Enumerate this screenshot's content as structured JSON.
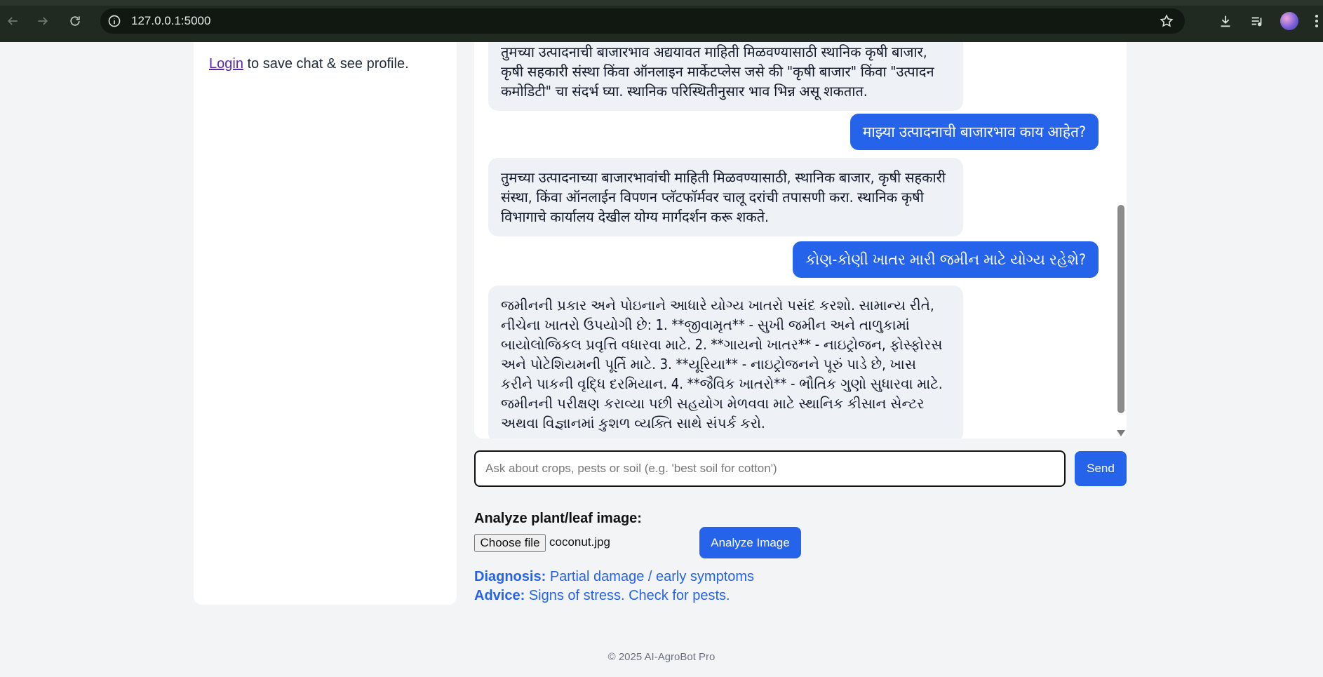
{
  "browser": {
    "url": "127.0.0.1:5000"
  },
  "sidebar": {
    "login_link": "Login",
    "login_text": " to save chat & see profile."
  },
  "chat": {
    "messages": [
      {
        "role": "bot",
        "text": "तुमच्या उत्पादनाची बाजारभाव अद्ययावत माहिती मिळवण्यासाठी स्थानिक कृषी बाजार, कृषी सहकारी संस्था किंवा ऑनलाइन मार्केटप्लेस जसे की \"कृषी बाजार\" किंवा \"उत्पादन कमोडिटी\" चा संदर्भ घ्या. स्थानिक परिस्थितीनुसार भाव भिन्न असू शकतात."
      },
      {
        "role": "user",
        "text": "माझ्या उत्पादनाची बाजारभाव काय आहेत?"
      },
      {
        "role": "bot",
        "text": "तुमच्या उत्पादनाच्या बाजारभावांची माहिती मिळवण्यासाठी, स्थानिक बाजार, कृषी सहकारी संस्था, किंवा ऑनलाईन विपणन प्लॅटफॉर्मवर चालू दरांची तपासणी करा. स्थानिक कृषी विभागाचे कार्यालय देखील योग्य मार्गदर्शन करू शकते."
      },
      {
        "role": "user",
        "text": "કોણ-કોણી ખાતર મારી જમીન માટે યોગ્ય રહેશે?"
      },
      {
        "role": "bot",
        "text": "જમીનની પ્રકાર અને પોઇનાને આધારે યોગ્ય ખાતરો પસંદ કરશો. સામાન્ય રીતે, નીચેના ખાતરો ઉપયોગી છે: 1. **જીવામૃત** - સુખી જમીન અને તાળુકામાં બાયોલોજિકલ પ્રવૃત્તિ વધારવા માટે. 2. **ગાયનો ખાતર** - નાઇટ્રોજન, ફોસ્ફોરસ અને પોટેશિયમની પૂર્તિ માટે. 3. **યૂરિયા** - નાઇટ્રોજનને પૂરું પાડે છે, ખાસ કરીને પાકની વૃદ્ધિ દરમિયાન. 4. **જૈવિક ખાતરો** - ભૌતિક ગુણો સુધારવા માટે. જમીનની પરીક્ષણ કરાવ્યા પછી સહયોગ મેળવવા માટે સ્થાનિક કીસાન સેન્ટર અથવા વિજ્ઞાનમાં કુશળ વ્યક્તિ સાથે સંપર્ક કરો."
      }
    ],
    "input_placeholder": "Ask about crops, pests or soil (e.g. 'best soil for cotton')",
    "send_label": "Send"
  },
  "image_analysis": {
    "title": "Analyze plant/leaf image:",
    "choose_file_label": "Choose file",
    "file_name": "coconut.jpg",
    "analyze_label": "Analyze Image",
    "diagnosis_label": "Diagnosis:",
    "diagnosis_value": "Partial damage / early symptoms",
    "advice_label": "Advice:",
    "advice_value": "Signs of stress. Check for pests."
  },
  "footer": "© 2025 AI-AgroBot Pro"
}
